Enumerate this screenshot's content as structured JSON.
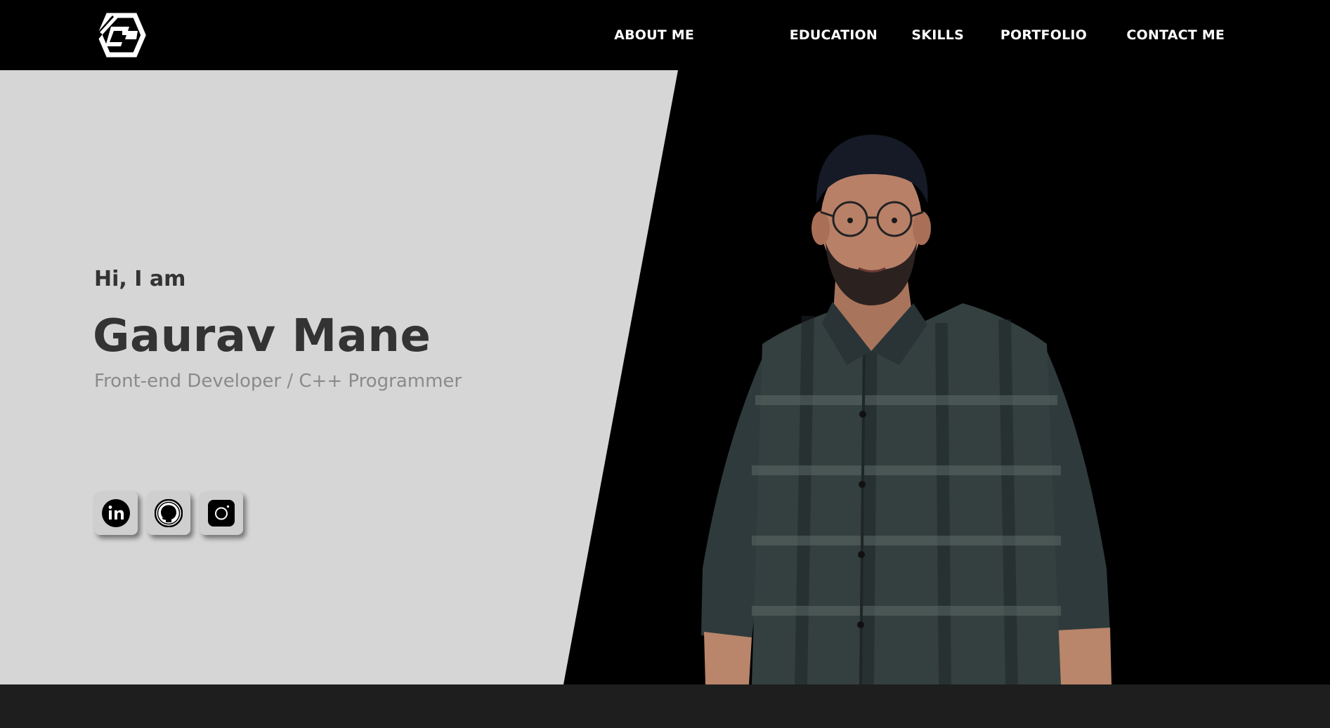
{
  "header": {
    "logo_text": "G",
    "nav": [
      {
        "label": "ABOUT ME"
      },
      {
        "label": "EDUCATION"
      },
      {
        "label": "SKILLS"
      },
      {
        "label": "PORTFOLIO"
      },
      {
        "label": "CONTACT ME"
      }
    ]
  },
  "hero": {
    "greeting": "Hi, I am",
    "name": "Gaurav Mane",
    "role": "Front-end Developer / C++ Programmer",
    "socials": [
      {
        "icon": "linkedin-icon"
      },
      {
        "icon": "github-icon"
      },
      {
        "icon": "instagram-icon"
      }
    ]
  },
  "colors": {
    "header_bg": "#000000",
    "hero_panel": "#d6d6d6",
    "heading_text": "#333333",
    "muted_text": "#8a8a8a",
    "nav_text": "#ffffff",
    "footer_strip": "#1e1e1e",
    "shirt": "#2f3a3c"
  }
}
